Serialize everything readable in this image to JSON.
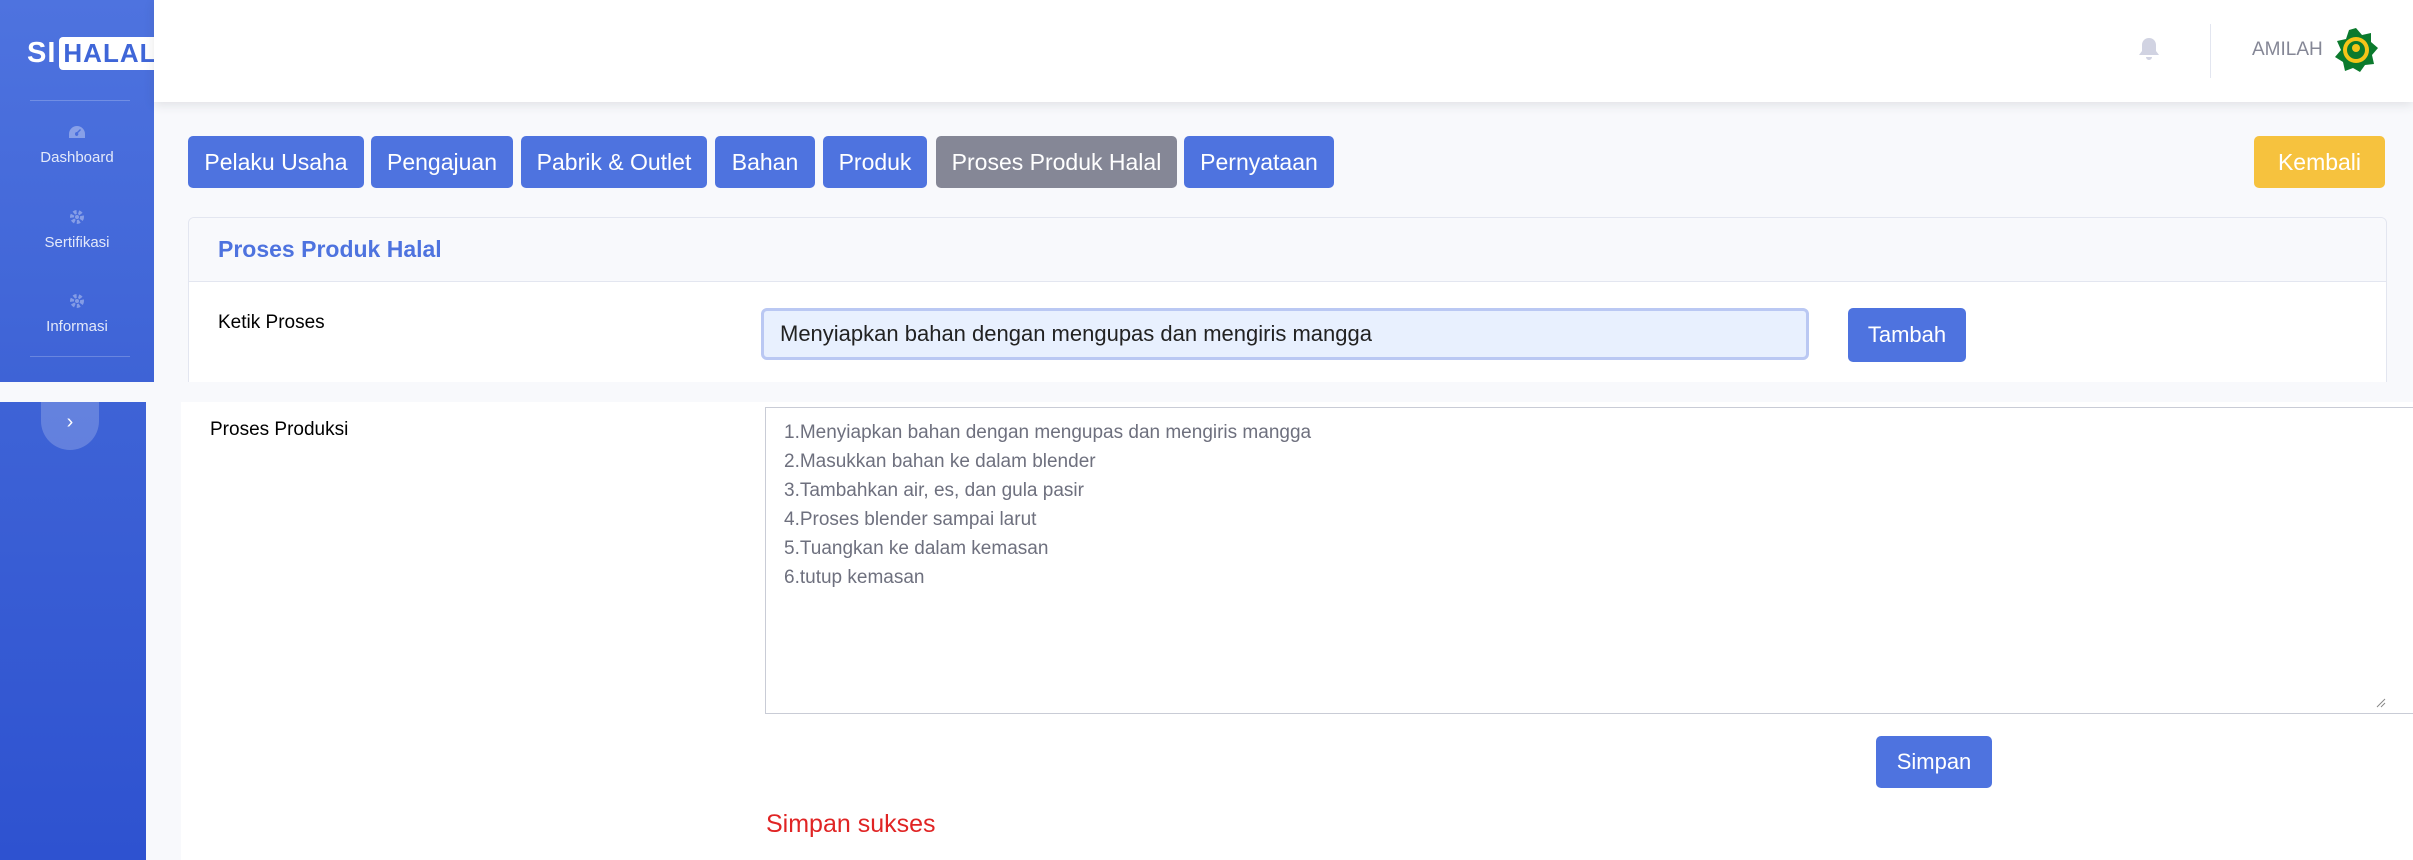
{
  "brand": {
    "si": "SI",
    "halal": "HALAL"
  },
  "sidebar": {
    "items": [
      {
        "label": "Dashboard",
        "icon": "tachometer-icon"
      },
      {
        "label": "Sertifikasi",
        "icon": "cog-icon"
      },
      {
        "label": "Informasi",
        "icon": "cog-icon"
      }
    ],
    "toggle_icon": "chevron-right-icon"
  },
  "topbar": {
    "user_name": "AMILAH",
    "bell_icon": "bell-icon",
    "avatar": "kemenag-logo"
  },
  "tabs": [
    {
      "label": "Pelaku Usaha"
    },
    {
      "label": "Pengajuan"
    },
    {
      "label": "Pabrik & Outlet"
    },
    {
      "label": "Bahan"
    },
    {
      "label": "Produk"
    },
    {
      "label": "Proses Produk Halal",
      "active": true
    },
    {
      "label": "Pernyataan"
    }
  ],
  "back_button": "Kembali",
  "card": {
    "title": "Proses Produk Halal",
    "ketik_label": "Ketik Proses",
    "ketik_value": "Menyiapkan bahan dengan mengupas dan mengiris mangga",
    "tambah_label": "Tambah",
    "produksi_label": "Proses Produksi",
    "steps": [
      "1.Menyiapkan bahan dengan mengupas dan mengiris mangga",
      "2.Masukkan bahan ke dalam blender",
      "3.Tambahkan air, es, dan gula pasir",
      "4.Proses blender sampai larut",
      "5.Tuangkan ke dalam kemasan",
      "6.tutup kemasan"
    ],
    "simpan_label": "Simpan",
    "status_message": "Simpan sukses"
  },
  "colors": {
    "primary": "#4e73df",
    "secondary": "#858796",
    "warning": "#f6c23e",
    "danger": "#e02424"
  }
}
